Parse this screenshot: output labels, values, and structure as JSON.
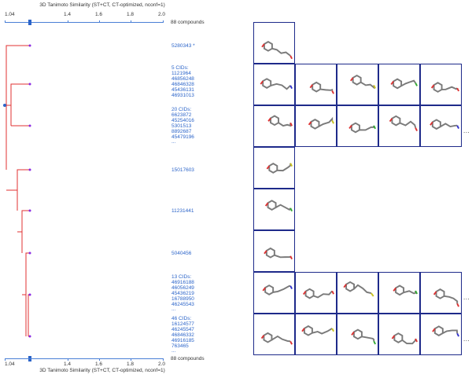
{
  "axis": {
    "title": "3D Tanimoto Similarity (ST+CT, CT-optimized, nconf=1)",
    "ticks": [
      "1.04",
      "1.4",
      "1.6",
      "1.8",
      "2.0"
    ],
    "compound_count": "88 compounds"
  },
  "clusters": [
    {
      "label_lines": [
        "5280343 *"
      ],
      "mol_count": 1,
      "more": false
    },
    {
      "label_lines": [
        "5 CIDs:",
        "1121964",
        "46856248",
        "46846328",
        "45436131",
        "46931013"
      ],
      "mol_count": 5,
      "more": false
    },
    {
      "label_lines": [
        "20 CIDs:",
        "6623872",
        "45254016",
        "5301513",
        "8892687",
        "45479196",
        "..."
      ],
      "mol_count": 5,
      "more": true
    },
    {
      "label_lines": [
        "15017603"
      ],
      "mol_count": 1,
      "more": false
    },
    {
      "label_lines": [
        "11231441"
      ],
      "mol_count": 1,
      "more": false
    },
    {
      "label_lines": [
        "5040456"
      ],
      "mol_count": 1,
      "more": false
    },
    {
      "label_lines": [
        "13 CIDs:",
        "46916188",
        "46056249",
        "45436219",
        "16788950",
        "46245543",
        "..."
      ],
      "mol_count": 5,
      "more": true
    },
    {
      "label_lines": [
        "46 CIDs:",
        "16124577",
        "46245547",
        "46846332",
        "46916185",
        "763465",
        "..."
      ],
      "mol_count": 5,
      "more": true
    }
  ],
  "more_symbol": "...",
  "colors": {
    "dendrogram": "#e03030",
    "node": "#8a2be2",
    "axis": "#4a7fd6",
    "label": "#2b64c9",
    "frame": "#1e2a8a"
  }
}
